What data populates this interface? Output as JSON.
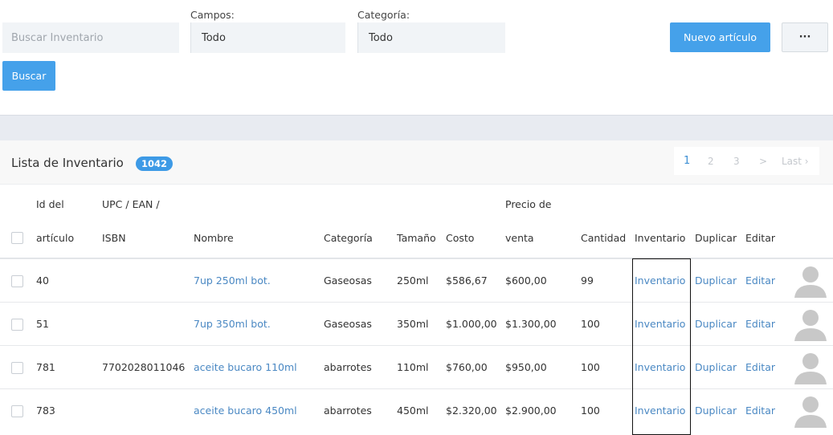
{
  "filters": {
    "search_placeholder": "Buscar Inventario",
    "campos_label": "Campos:",
    "campos_value": "Todo",
    "categoria_label": "Categoría:",
    "categoria_value": "Todo",
    "search_button": "Buscar",
    "new_button": "Nuevo artículo",
    "more_button": "···"
  },
  "panel": {
    "title": "Lista de Inventario",
    "count": "1042",
    "pagination": [
      "1",
      "2",
      "3",
      ">",
      "Last ›"
    ]
  },
  "columns": {
    "id_line1": "Id del",
    "id_line2": "artículo",
    "upc_line1": "UPC / EAN /",
    "upc_line2": "ISBN",
    "nombre": "Nombre",
    "categoria": "Categoría",
    "tamano": "Tamaño",
    "costo": "Costo",
    "precio_line1": "Precio de",
    "precio_line2": "venta",
    "cantidad": "Cantidad",
    "inventario": "Inventario",
    "duplicar": "Duplicar",
    "editar": "Editar"
  },
  "rows": [
    {
      "id": "40",
      "upc": "",
      "nombre": "7up 250ml bot.",
      "categoria": "Gaseosas",
      "tamano": "250ml",
      "costo": "$586,67",
      "precio": "$600,00",
      "cantidad": "99",
      "inventario": "Inventario",
      "duplicar": "Duplicar",
      "editar": "Editar"
    },
    {
      "id": "51",
      "upc": "",
      "nombre": "7up 350ml bot.",
      "categoria": "Gaseosas",
      "tamano": "350ml",
      "costo": "$1.000,00",
      "precio": "$1.300,00",
      "cantidad": "100",
      "inventario": "Inventario",
      "duplicar": "Duplicar",
      "editar": "Editar"
    },
    {
      "id": "781",
      "upc": "7702028011046",
      "nombre": "aceite bucaro 110ml",
      "categoria": "abarrotes",
      "tamano": "110ml",
      "costo": "$760,00",
      "precio": "$950,00",
      "cantidad": "100",
      "inventario": "Inventario",
      "duplicar": "Duplicar",
      "editar": "Editar"
    },
    {
      "id": "783",
      "upc": "",
      "nombre": "aceite bucaro 450ml",
      "categoria": "abarrotes",
      "tamano": "450ml",
      "costo": "$2.320,00",
      "precio": "$2.900,00",
      "cantidad": "100",
      "inventario": "Inventario",
      "duplicar": "Duplicar",
      "editar": "Editar"
    }
  ],
  "colors": {
    "primary": "#45a1ea",
    "link": "#4a88c3",
    "badge": "#3d9ae6",
    "input_bg": "#f1f4f7",
    "avatar": "#c8c8c8"
  }
}
